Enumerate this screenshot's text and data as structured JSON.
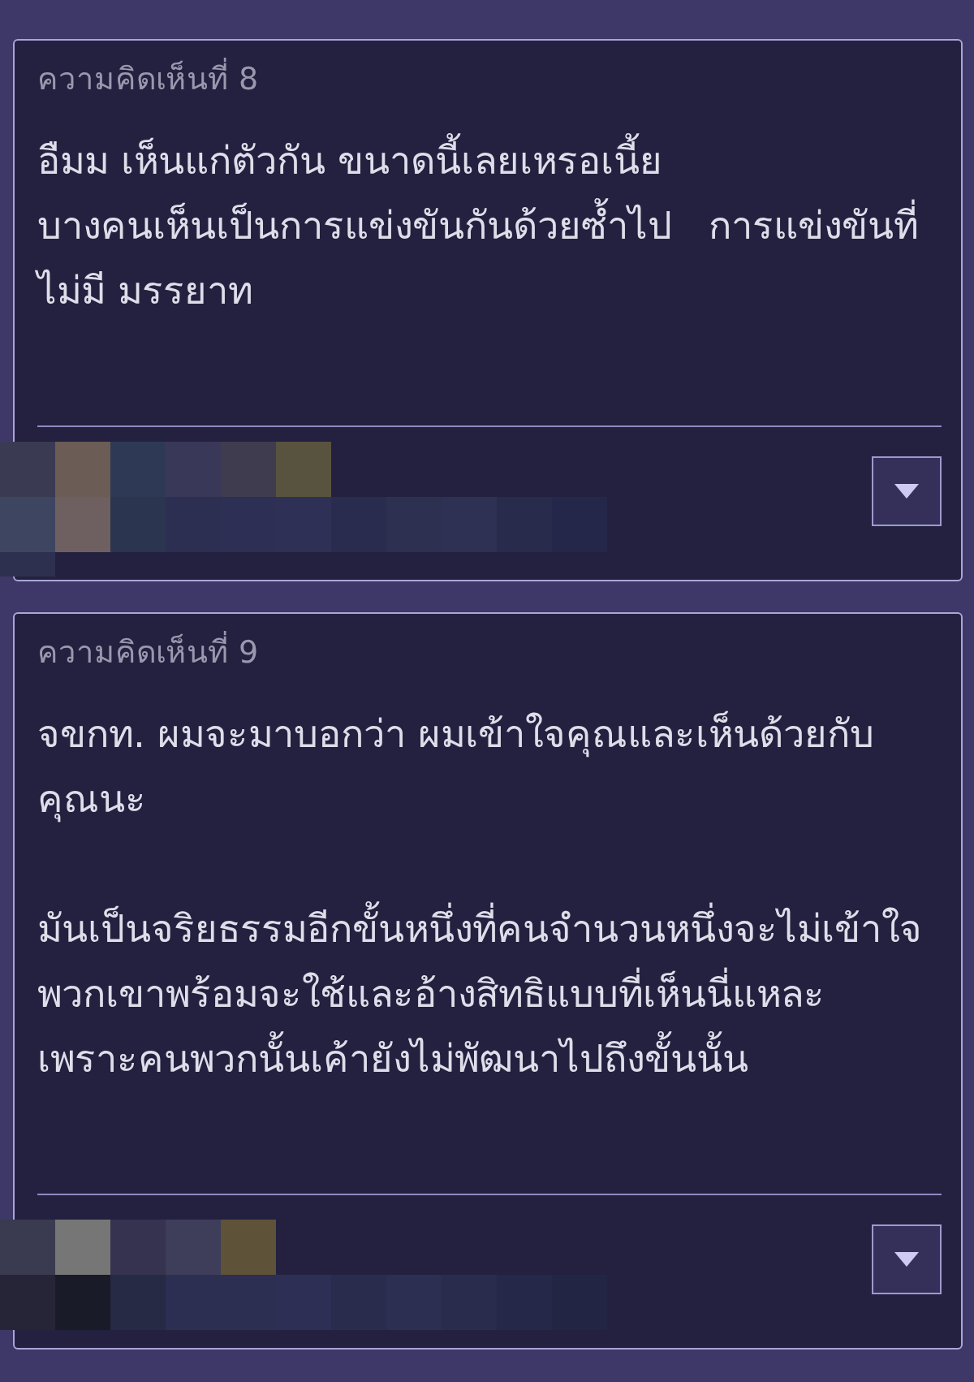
{
  "comments": [
    {
      "label": "ความคิดเห็นที่ 8",
      "paragraphs": [
        {
          "lines": [
            "อืมม เห็นแก่ตัวกัน ขนาดนี้เลยเหรอเนี้ย",
            "บางคนเห็นเป็นการแข่งขันกันด้วยซ้ำไป   การแข่งขันที่",
            "ไม่มี มรรยาท"
          ]
        }
      ]
    },
    {
      "label": "ความคิดเห็นที่ 9",
      "paragraphs": [
        {
          "lines": [
            "จขกท. ผมจะมาบอกว่า ผมเข้าใจคุณและเห็นด้วยกับ",
            "คุณนะ"
          ]
        },
        {
          "lines": [
            "มันเป็นจริยธรรมอีกขั้นหนึ่งที่คนจำนวนหนึ่งจะไม่เข้าใจ",
            "พวกเขาพร้อมจะใช้และอ้างสิทธิแบบที่เห็นนี่แหละ",
            "เพราะคนพวกนั้นเค้ายังไม่พัฒนาไปถึงขั้นนั้น"
          ]
        }
      ]
    }
  ]
}
